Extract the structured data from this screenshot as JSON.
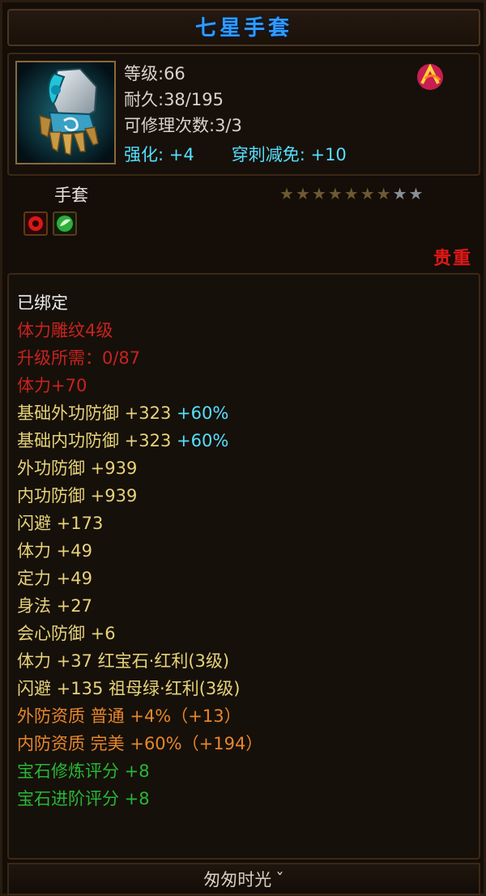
{
  "item": {
    "name": "七星手套",
    "level": "等级:66",
    "durability": "耐久:38/195",
    "repairs": "可修理次数:3/3",
    "enhance": "强化: +4",
    "pierce": "穿刺减免: +10",
    "type": "手套",
    "rarity": "贵重",
    "stars_filled": 7,
    "stars_total": 9
  },
  "colors": {
    "title": "#2f9bff",
    "bound": "#eeeeee",
    "red": "#c8231f",
    "yellow": "#e6d27a",
    "cyan": "#54e0ff",
    "orange": "#e6862c",
    "green": "#26b835"
  },
  "icons": [
    "glove-item-icon",
    "set-badge-icon",
    "red-gem-socket-icon",
    "green-gem-socket-icon",
    "chevron-down-icon"
  ],
  "attributes": {
    "bound": "已绑定",
    "l1": "体力雕纹4级",
    "l2": "升级所需：0/87",
    "l3": "体力+70",
    "l4_label": "基础外功防御 +323",
    "l4_pct": "+60%",
    "l5_label": "基础内功防御 +323",
    "l5_pct": "+60%",
    "l6": "外功防御 +939",
    "l7": "内功防御 +939",
    "l8": "闪避 +173",
    "l9": "体力 +49",
    "l10": "定力 +49",
    "l11": "身法 +27",
    "l12": "会心防御 +6",
    "l13": "体力 +37 红宝石·红利(3级)",
    "l14": "闪避 +135 祖母绿·红利(3级)",
    "l15": "外防资质  普通 +4%（+13）",
    "l16": "内防资质  完美 +60%（+194）",
    "l17": "宝石修炼评分 +8",
    "l18": "宝石进阶评分 +8"
  },
  "footer": {
    "text": "匆匆时光"
  }
}
